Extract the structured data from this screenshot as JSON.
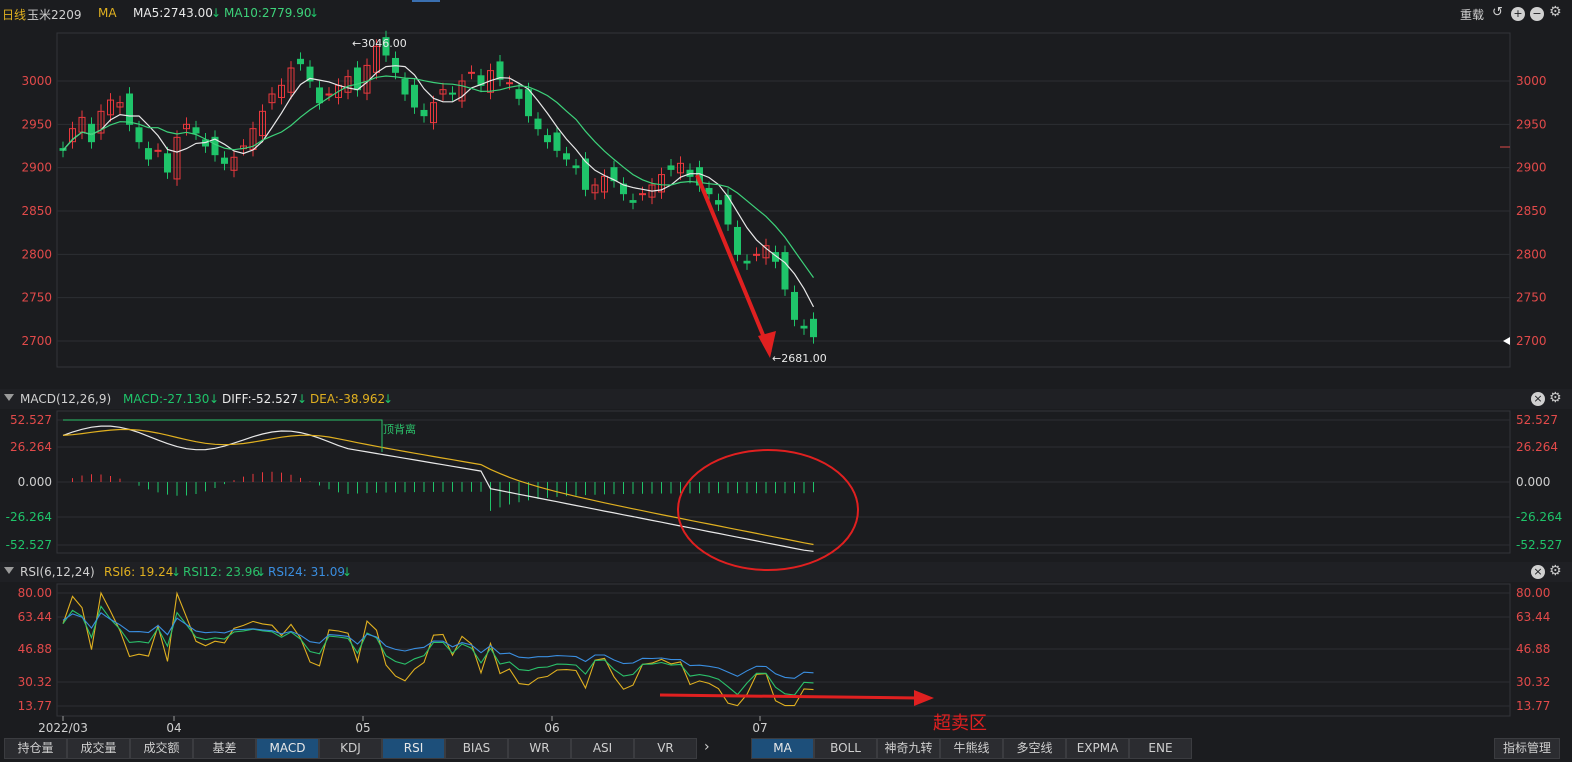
{
  "header": {
    "period": "日线",
    "symbol": "玉米2209",
    "indicator": "MA",
    "ma5": "MA5:2743.00",
    "ma10": "MA10:2779.90",
    "reload": "重载"
  },
  "main_chart": {
    "price_ticks": [
      "3000",
      "2950",
      "2900",
      "2850",
      "2800",
      "2750",
      "2700"
    ],
    "high_label": "3046.00",
    "low_label": "2681.00"
  },
  "macd_panel": {
    "title": "MACD(12,26,9)",
    "macd": "MACD:-27.130",
    "diff": "DIFF:-52.527",
    "dea": "DEA:-38.962",
    "ticks": [
      "52.527",
      "26.264",
      "0.000",
      "-26.264",
      "-52.527"
    ],
    "annotation": "顶背离"
  },
  "rsi_panel": {
    "title": "RSI(6,12,24)",
    "rsi6": "RSI6: 19.24",
    "rsi12": "RSI12: 23.96",
    "rsi24": "RSI24: 31.09",
    "ticks": [
      "80.00",
      "63.44",
      "46.88",
      "30.32",
      "13.77"
    ],
    "annotation": "超卖区"
  },
  "x_axis": [
    "2022/03",
    "04",
    "05",
    "06",
    "07"
  ],
  "bottom_tabs_left": [
    "持仓量",
    "成交量",
    "成交额",
    "基差",
    "MACD",
    "KDJ",
    "RSI",
    "BIAS",
    "WR",
    "ASI",
    "VR"
  ],
  "bottom_tabs_right": [
    "MA",
    "BOLL",
    "神奇九转",
    "牛熊线",
    "多空线",
    "EXPMA",
    "ENE"
  ],
  "manage_button": "指标管理",
  "colors": {
    "up": "#e8383d",
    "down": "#1fc46a",
    "ma5": "#e8e8e8",
    "ma10": "#3dd27a",
    "dea": "#e0b020",
    "rsi6": "#e0b020",
    "rsi12": "#2bc06a",
    "rsi24": "#3a8ee0"
  }
}
